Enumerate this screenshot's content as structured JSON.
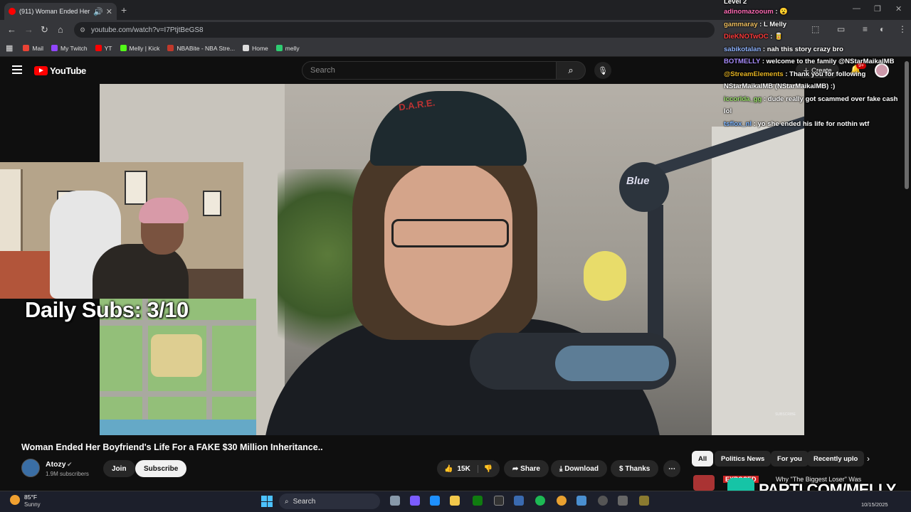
{
  "browser": {
    "tab_title": "(911) Woman Ended Her Bo",
    "url": "youtube.com/watch?v=I7PtjtBeGS8",
    "bookmarks": [
      {
        "label": "Mail",
        "color": "#ea4335"
      },
      {
        "label": "My Twitch",
        "color": "#9146ff"
      },
      {
        "label": "YT",
        "color": "#ff0000"
      },
      {
        "label": "Melly | Kick",
        "color": "#53fc18"
      },
      {
        "label": "NBABite - NBA Stre...",
        "color": "#c0392b"
      },
      {
        "label": "Home",
        "color": "#dddddd"
      },
      {
        "label": "melly",
        "color": "#2ecc71"
      }
    ]
  },
  "youtube": {
    "logo_text": "YouTube",
    "search_placeholder": "Search",
    "create_label": "Create",
    "notif_badge": "9+"
  },
  "overlay": {
    "daily_subs": "Daily Subs: 3/10",
    "cap_text": "D.A.R.E.",
    "mic_brand": "Blue",
    "video_watermark": "SUBSCRIBE"
  },
  "chat": [
    {
      "user": "Level 2",
      "user_color": "#ffffff",
      "message": ""
    },
    {
      "user": "adinomazooum",
      "user_color": "#ff6bb5",
      "message": ": 😮"
    },
    {
      "user": "gammaray",
      "user_color": "#f0c060",
      "message": ": L Melly"
    },
    {
      "user": "DieKNOTwOC",
      "user_color": "#ff3b3b",
      "message": ": 🥫"
    },
    {
      "user": "sabikotalan",
      "user_color": "#8fb4ff",
      "message": ": nah this story crazy bro"
    },
    {
      "user": "BOTMELLY",
      "user_color": "#a78bfa",
      "message": ": welcome to the family @NStarMaikalMB"
    },
    {
      "user": "@StreamElements",
      "user_color": "#e6b422",
      "message": ": Thank you for following NStarMaikalMB (NStarMaikalMB) :)"
    },
    {
      "user": "iccorlda_gg",
      "user_color": "#9be36a",
      "message": ": dude really got scammed over fake cash lol"
    },
    {
      "user": "tsflox_nl",
      "user_color": "#7db5ff",
      "message": ": yo she ended his life for nothin wtf"
    }
  ],
  "video": {
    "title": "Woman Ended Her Boyfriend's Life For a FAKE $30 Million Inheritance..",
    "channel": "Atozy",
    "subscribers": "1.9M subscribers",
    "join_label": "Join",
    "subscribe_label": "Subscribe",
    "likes": "15K",
    "share_label": "Share",
    "download_label": "Download",
    "thanks_label": "Thanks"
  },
  "sidebar": {
    "chips": [
      "All",
      "Politics News",
      "For you",
      "Recently uplo"
    ],
    "rec_title": "Why \"The Biggest Loser\" Was",
    "rec_thumb_text": "EXPOSED",
    "promo": "PARTI.COM/MELLY"
  },
  "taskbar": {
    "temp": "85°F",
    "condition": "Sunny",
    "search": "Search",
    "date": "10/15/2025"
  },
  "colors": {
    "yt_red": "#ff0000",
    "bg": "#0f0f0f",
    "parti_teal": "#16c4a6"
  }
}
